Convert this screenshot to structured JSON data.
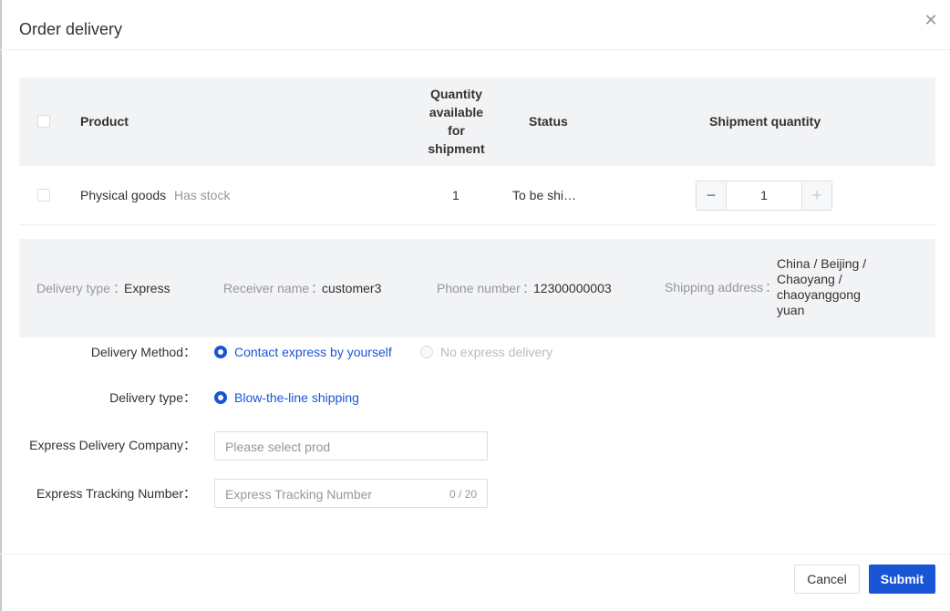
{
  "dialog": {
    "title": "Order delivery",
    "close_icon": "close-icon"
  },
  "table": {
    "headers": {
      "product": "Product",
      "quantity_available": "Quantity available for shipment",
      "status": "Status",
      "shipment_quantity": "Shipment quantity"
    },
    "rows": [
      {
        "product": "Physical goods",
        "stock": "Has stock",
        "quantity_available": "1",
        "status": "To be shi…",
        "shipment_quantity": "1",
        "minus": "−",
        "plus": "+"
      }
    ]
  },
  "info": {
    "delivery_type_label": "Delivery type",
    "delivery_type_value": "Express",
    "receiver_label": "Receiver name",
    "receiver_value": "customer3",
    "phone_label": "Phone number",
    "phone_value": "12300000003",
    "address_label": "Shipping address",
    "address_value": "China / Beijing / Chaoyang / chaoyanggong yuan",
    "separator": "："
  },
  "form": {
    "delivery_method": {
      "label": "Delivery Method：",
      "options": [
        "Contact express by yourself",
        "No express delivery"
      ],
      "selected": "Contact express by yourself"
    },
    "delivery_type": {
      "label": "Delivery type：",
      "options": [
        "Blow-the-line shipping"
      ],
      "selected": "Blow-the-line shipping"
    },
    "express_company": {
      "label": "Express Delivery Company：",
      "placeholder": "Please select prod"
    },
    "tracking_number": {
      "label": "Express Tracking Number：",
      "placeholder": "Express Tracking Number",
      "counter": "0 / 20"
    }
  },
  "footer": {
    "cancel_label": "Cancel",
    "submit_label": "Submit"
  },
  "colors": {
    "accent": "#1a55d6",
    "header_bg": "#f2f3f5",
    "muted_text": "#969799"
  }
}
